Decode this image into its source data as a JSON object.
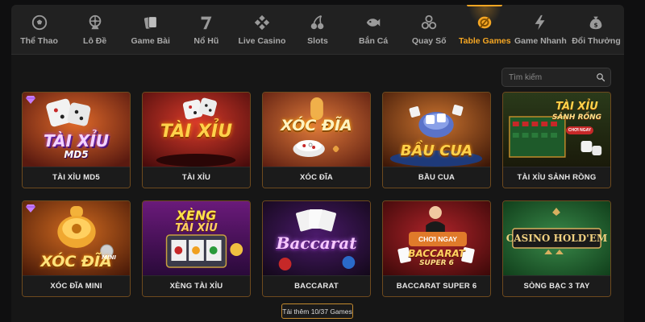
{
  "nav": {
    "items": [
      {
        "label": "Thể Thao",
        "icon": "soccer-ball-icon"
      },
      {
        "label": "Lô Đề",
        "icon": "lottery-wheel-icon"
      },
      {
        "label": "Game Bài",
        "icon": "cards-icon"
      },
      {
        "label": "Nổ Hũ",
        "icon": "slot-seven-icon"
      },
      {
        "label": "Live Casino",
        "icon": "diamond-cluster-icon"
      },
      {
        "label": "Slots",
        "icon": "cherries-icon"
      },
      {
        "label": "Bắn Cá",
        "icon": "fish-icon"
      },
      {
        "label": "Quay Số",
        "icon": "balls-icon"
      },
      {
        "label": "Table Games",
        "icon": "chip-icon",
        "active": true
      },
      {
        "label": "Game Nhanh",
        "icon": "lightning-icon"
      },
      {
        "label": "Đổi Thưởng",
        "icon": "money-bag-icon"
      }
    ]
  },
  "search": {
    "placeholder": "Tìm kiếm"
  },
  "games": [
    {
      "title": "TÀI XỈU MD5",
      "art_text": "TÀI XỈU",
      "art_sub": "MD5",
      "badge": "gem-icon"
    },
    {
      "title": "TÀI XỈU",
      "art_text": "TÀI XỈU"
    },
    {
      "title": "XÓC ĐĨA",
      "art_text": "XÓC ĐĨA"
    },
    {
      "title": "BẦU CUA",
      "art_text": "BẦU CUA"
    },
    {
      "title": "TÀI XỈU SẢNH RỒNG",
      "art_text": "TÀI XỈU",
      "art_sub": "SẢNH RỒNG",
      "art_button": "CHƠI NGAY"
    },
    {
      "title": "XÓC ĐĨA MINI",
      "art_text": "XÓC ĐĨA",
      "art_sub": "MINI",
      "badge": "gem-icon"
    },
    {
      "title": "XÈNG TÀI XỈU",
      "art_text": "XÈNG",
      "art_sub": "TÀI XỈU"
    },
    {
      "title": "BACCARAT",
      "art_text": "Baccarat"
    },
    {
      "title": "BACCARAT SUPER 6",
      "art_text": "BACCARAT",
      "art_sub": "SUPER 6",
      "art_button": "CHƠI NGAY"
    },
    {
      "title": "SÒNG BẠC 3 TAY",
      "art_text": "CASINO HOLD'EM"
    }
  ],
  "load_more": "Tải thêm 10/37 Games",
  "colors": {
    "accent": "#f5a623",
    "card_border": "#6e4a1e",
    "background": "#161616"
  }
}
